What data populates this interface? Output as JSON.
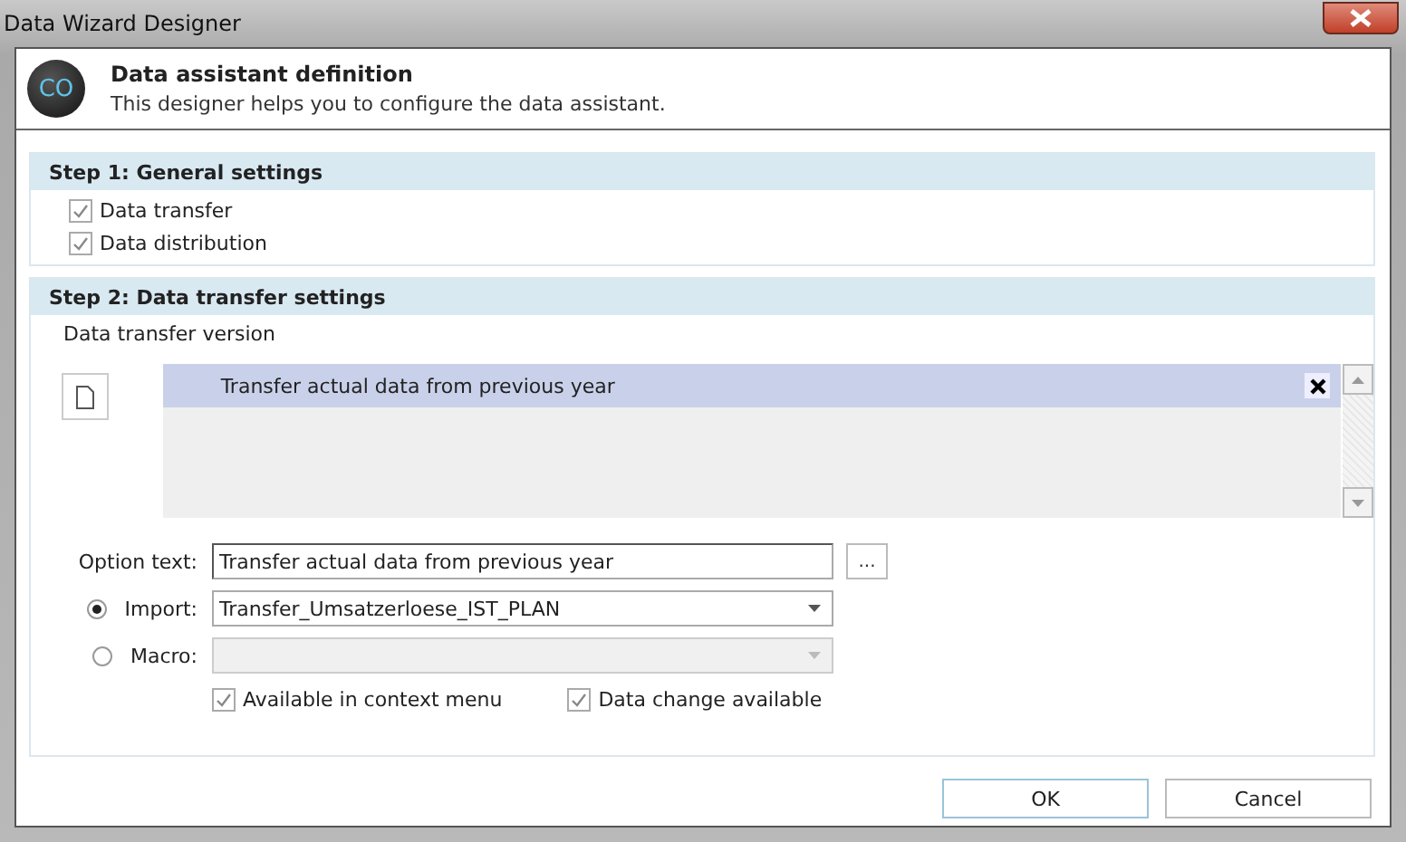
{
  "window": {
    "title": "Data Wizard Designer"
  },
  "header": {
    "logo": "CO",
    "title": "Data assistant definition",
    "subtitle": "This designer helps you to configure the data assistant."
  },
  "step1": {
    "title": "Step 1: General settings",
    "options": [
      {
        "label": "Data transfer",
        "checked": true
      },
      {
        "label": "Data distribution",
        "checked": true
      }
    ]
  },
  "step2": {
    "title": "Step 2: Data transfer settings",
    "version_label": "Data transfer version",
    "versions": [
      {
        "label": "Transfer actual data from previous year",
        "selected": true
      }
    ],
    "option_text": {
      "label": "Option text:",
      "value": "Transfer actual data from previous year",
      "button": "..."
    },
    "sources": [
      {
        "label": "Import:",
        "selected": true,
        "value": "Transfer_Umsatzerloese_IST_PLAN",
        "disabled": false
      },
      {
        "label": "Macro:",
        "selected": false,
        "disabled": true
      }
    ],
    "flags": [
      {
        "label": "Available in context menu",
        "checked": true
      },
      {
        "label": "Data change available",
        "checked": true
      }
    ]
  },
  "buttons": [
    "OK",
    "Cancel"
  ]
}
